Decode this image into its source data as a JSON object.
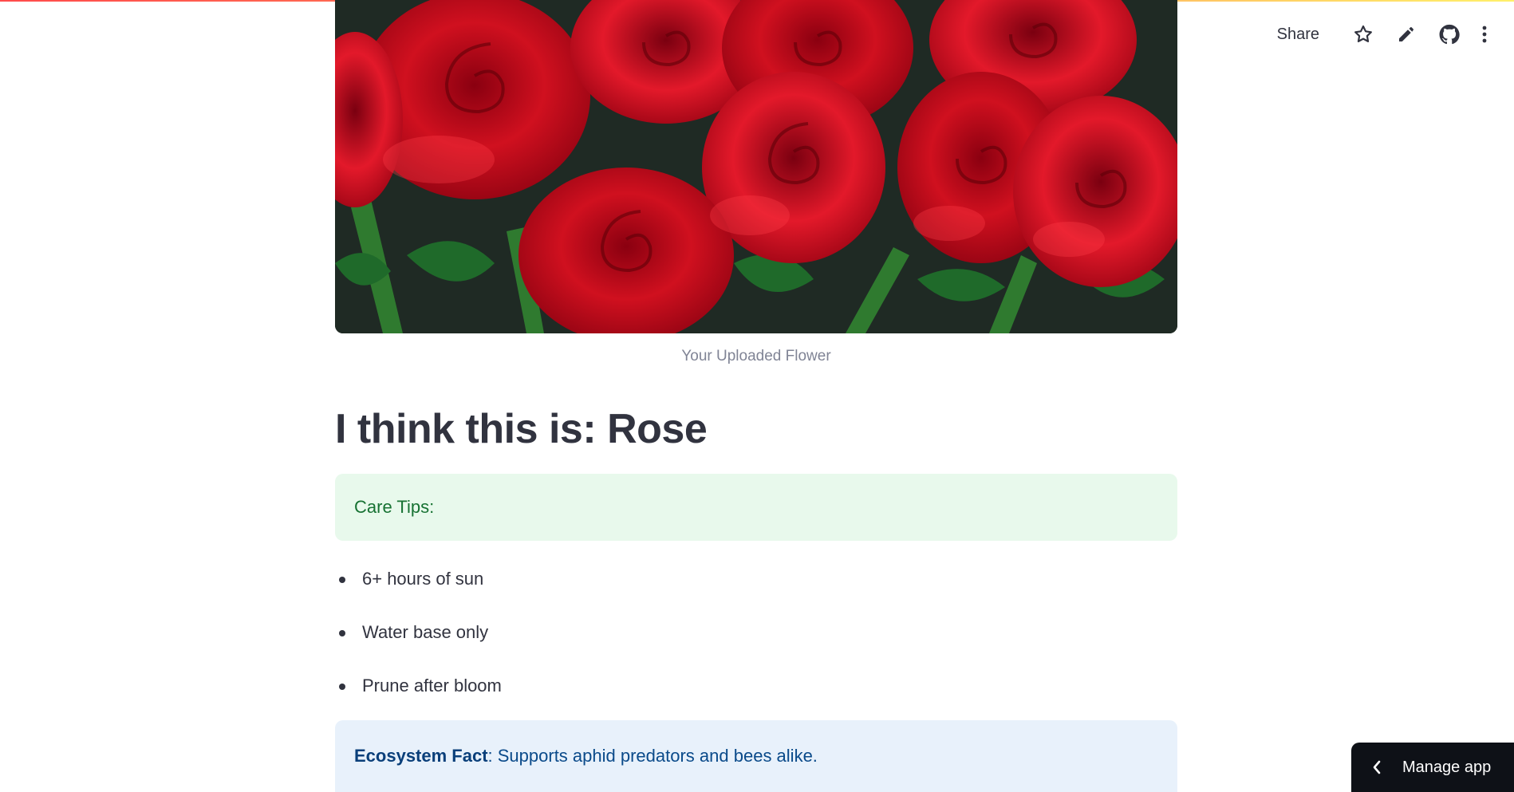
{
  "toolbar": {
    "share_label": "Share"
  },
  "image": {
    "caption": "Your Uploaded Flower"
  },
  "result": {
    "heading": "I think this is: Rose"
  },
  "care": {
    "title": "Care Tips:",
    "tips": [
      "6+ hours of sun",
      "Water base only",
      "Prune after bloom"
    ]
  },
  "fact": {
    "label": "Ecosystem Fact",
    "text": ": Supports aphid predators and bees alike."
  },
  "manage_app": {
    "label": "Manage app"
  },
  "colors": {
    "accent_red": "#ff4b4b",
    "success_bg": "#e8f9ec",
    "success_text": "#177233",
    "info_bg": "#e8f1fb",
    "info_text": "#0a4a8a"
  }
}
